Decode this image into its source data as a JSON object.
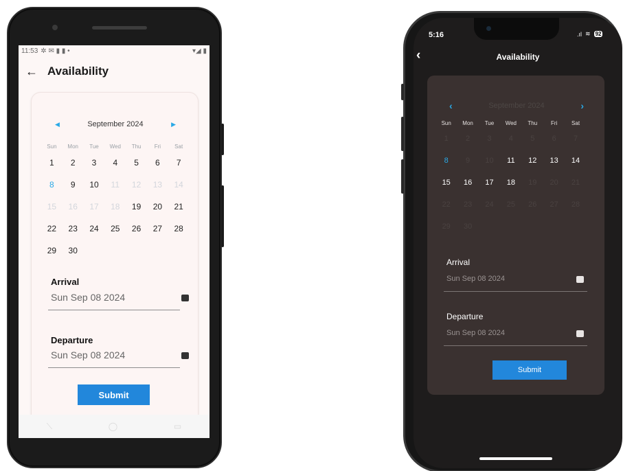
{
  "android": {
    "status_time": "11:53",
    "status_icons": "✲ ✉ ▮ ▮ •",
    "status_right": "▾◢ ▮",
    "title": "Availability",
    "calendar": {
      "month": "September 2024",
      "weekdays": [
        "Sun",
        "Mon",
        "Tue",
        "Wed",
        "Thu",
        "Fri",
        "Sat"
      ],
      "weeks": [
        [
          "1",
          "2",
          "3",
          "4",
          "5",
          "6",
          "7"
        ],
        [
          "8",
          "9",
          "10",
          "11",
          "12",
          "13",
          "14"
        ],
        [
          "15",
          "16",
          "17",
          "18",
          "19",
          "20",
          "21"
        ],
        [
          "22",
          "23",
          "24",
          "25",
          "26",
          "27",
          "28"
        ],
        [
          "29",
          "30",
          "",
          "",
          "",
          "",
          ""
        ]
      ]
    },
    "arrival_label": "Arrival",
    "arrival_value": "Sun Sep 08 2024",
    "departure_label": "Departure",
    "departure_value": "Sun Sep 08 2024",
    "submit_label": "Submit",
    "nav": [
      "⟍",
      "◯",
      "▭"
    ]
  },
  "ios": {
    "status_time": "5:16",
    "signal": ".ıl",
    "wifi": "≋",
    "battery": "92",
    "back": "‹",
    "title": "Availability",
    "calendar": {
      "prev": "‹",
      "next": "›",
      "month": "September 2024",
      "weekdays": [
        "Sun",
        "Mon",
        "Tue",
        "Wed",
        "Thu",
        "Fri",
        "Sat"
      ],
      "weeks": [
        [
          "1",
          "2",
          "3",
          "4",
          "5",
          "6",
          "7"
        ],
        [
          "8",
          "9",
          "10",
          "11",
          "12",
          "13",
          "14"
        ],
        [
          "15",
          "16",
          "17",
          "18",
          "19",
          "20",
          "21"
        ],
        [
          "22",
          "23",
          "24",
          "25",
          "26",
          "27",
          "28"
        ],
        [
          "29",
          "30",
          "",
          "",
          "",
          "",
          ""
        ]
      ]
    },
    "arrival_label": "Arrival",
    "arrival_value": "Sun Sep 08 2024",
    "departure_label": "Departure",
    "departure_value": "Sun Sep 08 2024",
    "submit_label": "Submit"
  },
  "colors": {
    "accent": "#2aa9e6",
    "button": "#2287db",
    "dark_card": "#3a3130"
  }
}
